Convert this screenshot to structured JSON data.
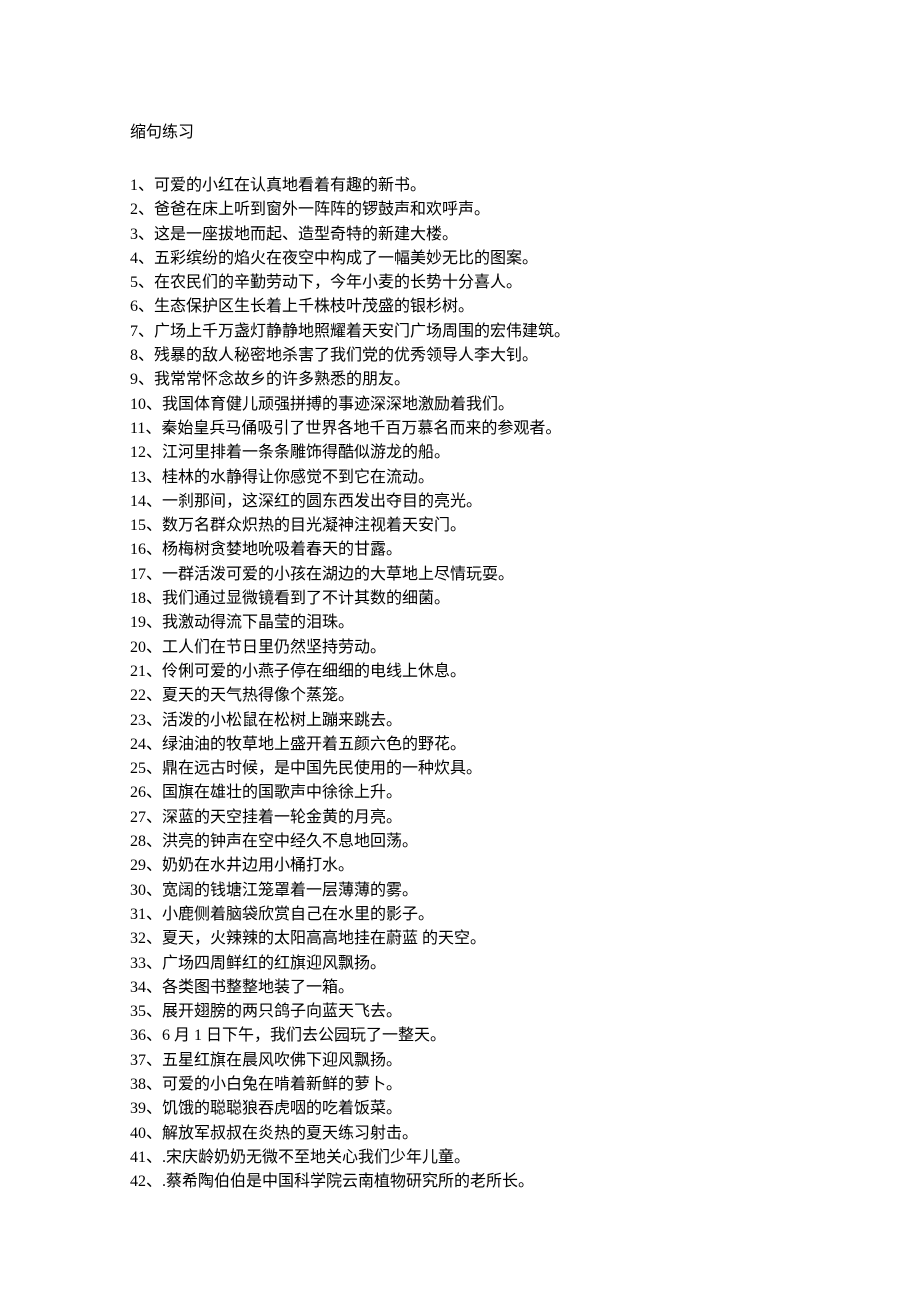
{
  "title": "缩句练习",
  "items": [
    "1、可爱的小红在认真地看着有趣的新书。",
    "2、爸爸在床上听到窗外一阵阵的锣鼓声和欢呼声。",
    "3、这是一座拔地而起、造型奇特的新建大楼。",
    "4、五彩缤纷的焰火在夜空中构成了一幅美妙无比的图案。",
    "5、在农民们的辛勤劳动下，今年小麦的长势十分喜人。",
    "6、生态保护区生长着上千株枝叶茂盛的银杉树。",
    "7、广场上千万盏灯静静地照耀着天安门广场周围的宏伟建筑。",
    "8、残暴的敌人秘密地杀害了我们党的优秀领导人李大钊。",
    "9、我常常怀念故乡的许多熟悉的朋友。",
    "10、我国体育健儿顽强拼搏的事迹深深地激励着我们。",
    "11、秦始皇兵马俑吸引了世界各地千百万慕名而来的参观者。",
    "12、江河里排着一条条雕饰得酷似游龙的船。",
    "13、桂林的水静得让你感觉不到它在流动。",
    "14、一刹那间，这深红的圆东西发出夺目的亮光。",
    "15、数万名群众炽热的目光凝神注视着天安门。",
    "16、杨梅树贪婪地吮吸着春天的甘露。",
    "17、一群活泼可爱的小孩在湖边的大草地上尽情玩耍。",
    "18、我们通过显微镜看到了不计其数的细菌。",
    "19、我激动得流下晶莹的泪珠。",
    "20、工人们在节日里仍然坚持劳动。",
    "21、伶俐可爱的小燕子停在细细的电线上休息。",
    "22、夏天的天气热得像个蒸笼。",
    "23、活泼的小松鼠在松树上蹦来跳去。",
    "24、绿油油的牧草地上盛开着五颜六色的野花。",
    "25、鼎在远古时候，是中国先民使用的一种炊具。",
    "26、国旗在雄壮的国歌声中徐徐上升。",
    "27、深蓝的天空挂着一轮金黄的月亮。",
    "28、洪亮的钟声在空中经久不息地回荡。",
    "29、奶奶在水井边用小桶打水。",
    "30、宽阔的钱塘江笼罩着一层薄薄的雾。",
    "31、小鹿侧着脑袋欣赏自己在水里的影子。",
    "32、夏天，火辣辣的太阳高高地挂在蔚蓝 的天空。",
    "33、广场四周鲜红的红旗迎风飘扬。",
    "34、各类图书整整地装了一箱。",
    "35、展开翅膀的两只鸽子向蓝天飞去。",
    "36、6 月 1 日下午，我们去公园玩了一整天。",
    "37、五星红旗在晨风吹佛下迎风飘扬。",
    "38、可爱的小白兔在啃着新鲜的萝卜。",
    "39、饥饿的聪聪狼吞虎咽的吃着饭菜。",
    "40、解放军叔叔在炎热的夏天练习射击。",
    "41、.宋庆龄奶奶无微不至地关心我们少年儿童。",
    "42、.蔡希陶伯伯是中国科学院云南植物研究所的老所长。"
  ]
}
